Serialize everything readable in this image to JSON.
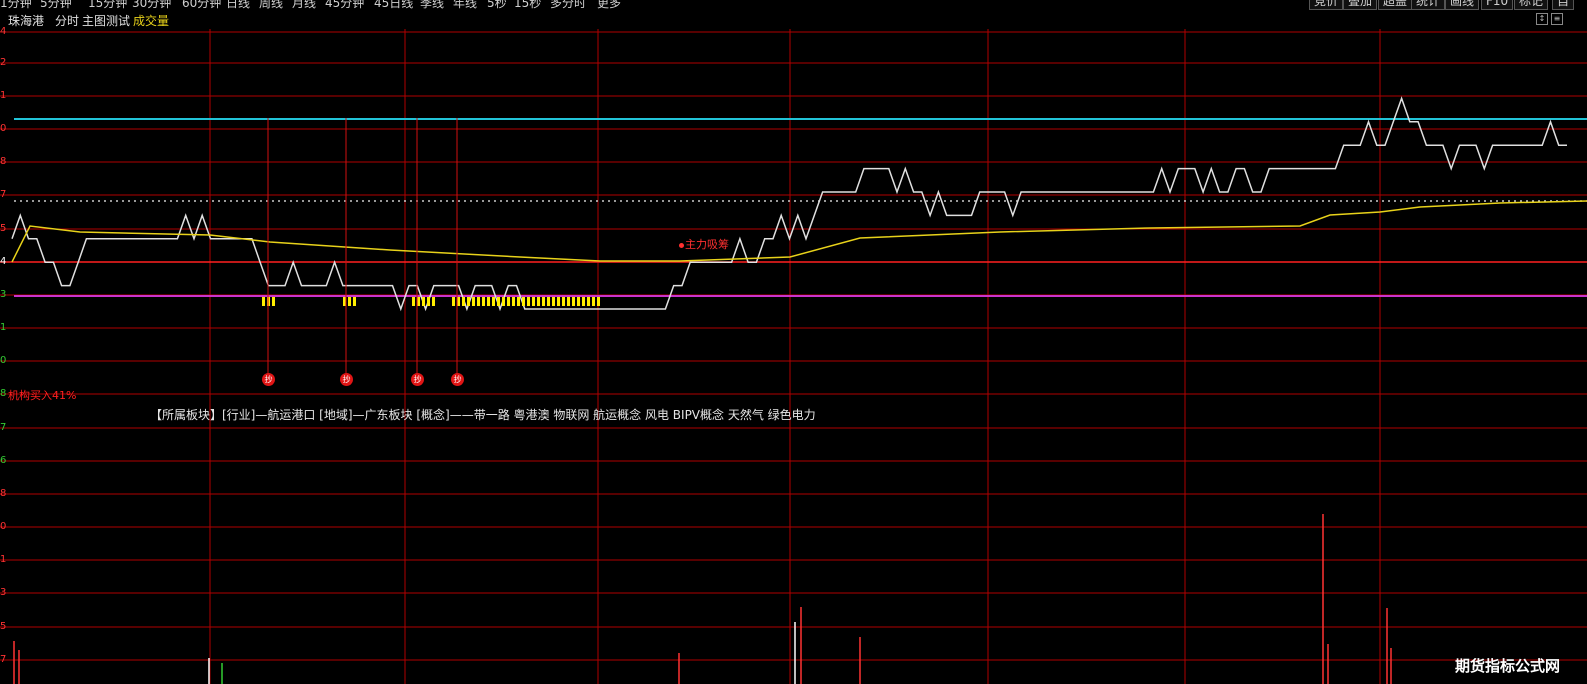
{
  "toolbar": {
    "periods": [
      "1分钟",
      "5分钟",
      "15分钟",
      "30分钟",
      "60分钟",
      "日线",
      "周线",
      "月线",
      "45分钟",
      "45日线",
      "季线",
      "年线",
      "5秒",
      "15秒",
      "多分时",
      "更多"
    ],
    "buttons": [
      "竞价",
      "叠加",
      "超盖",
      "统计",
      "画线",
      "F10",
      "标记",
      "自"
    ]
  },
  "titlebar": {
    "stock": "珠海港",
    "mode": "分时",
    "indicator": "主图测试",
    "volume_label": "成交量"
  },
  "y_axis": {
    "labels": [
      "4",
      "2",
      "1",
      "0",
      "8",
      "7",
      "5",
      "4",
      "3",
      "1",
      "0",
      "8",
      "7",
      "6",
      "8",
      "0",
      "1",
      "3",
      "5",
      "7"
    ],
    "colors": {
      "up": "#ff3333",
      "mid": "#ffffff",
      "down": "#33cc33"
    }
  },
  "annotations": {
    "institution": "机构买入41%",
    "main_force": "主力吸筹",
    "sectors": "【所属板块】[行业]—航运港口 [地域]—广东板块 [概念]——带一路 粤港澳 物联网 航运概念 风电 BIPV概念 天然气 绿色电力",
    "buy_badges": [
      "抄",
      "抄",
      "抄",
      "抄"
    ],
    "watermark": "期货指标公式网"
  },
  "colors": {
    "background": "#000000",
    "grid": "#b00000",
    "price_line": "#e0e0e0",
    "avg_line": "#e8d21a",
    "cyan_level": "#22c4d8",
    "magenta_level": "#cc33cc",
    "red_level": "#ff2020",
    "dotted_level": "#cccccc",
    "volume_up": "#ff3333",
    "volume_flat": "#ffffff",
    "volume_down": "#33cc33",
    "buy_marker": "#ffee00"
  },
  "chart_data": {
    "type": "line",
    "series": [],
    "intraday_price_steps": [
      6,
      7,
      6,
      6,
      5,
      5,
      4,
      4,
      5,
      6,
      6,
      6,
      6,
      6,
      6,
      6,
      6,
      6,
      6,
      6,
      6,
      7,
      6,
      7,
      6,
      6,
      6,
      6,
      6,
      6,
      5,
      4,
      4,
      4,
      5,
      4,
      4,
      4,
      4,
      5,
      4,
      4,
      4,
      4,
      4,
      4,
      4,
      3,
      4,
      4,
      3,
      4,
      4,
      4,
      4,
      3,
      4,
      4,
      4,
      3,
      4,
      4,
      3,
      3,
      3,
      3,
      3,
      3,
      3,
      3,
      3,
      3,
      3,
      3,
      3,
      3,
      3,
      3,
      3,
      3,
      4,
      4,
      5,
      5,
      5,
      5,
      5,
      5,
      6,
      5,
      5,
      6,
      6,
      7,
      6,
      7,
      6,
      7,
      8,
      8,
      8,
      8,
      8,
      9,
      9,
      9,
      9,
      8,
      9,
      8,
      8,
      7,
      8,
      7,
      7,
      7,
      7,
      8,
      8,
      8,
      8,
      7,
      8,
      8,
      8,
      8,
      8,
      8,
      8,
      8,
      8,
      8,
      8,
      8,
      8,
      8,
      8,
      8,
      8,
      9,
      8,
      9,
      9,
      9,
      8,
      9,
      8,
      8,
      9,
      9,
      8,
      8,
      9,
      9,
      9,
      9,
      9,
      9,
      9,
      9,
      9,
      10,
      10,
      10,
      11,
      10,
      10,
      11,
      12,
      11,
      11,
      10,
      10,
      10,
      9,
      10,
      10,
      10,
      9,
      10,
      10,
      10,
      10,
      10,
      10,
      10,
      11,
      10,
      10
    ]
  }
}
